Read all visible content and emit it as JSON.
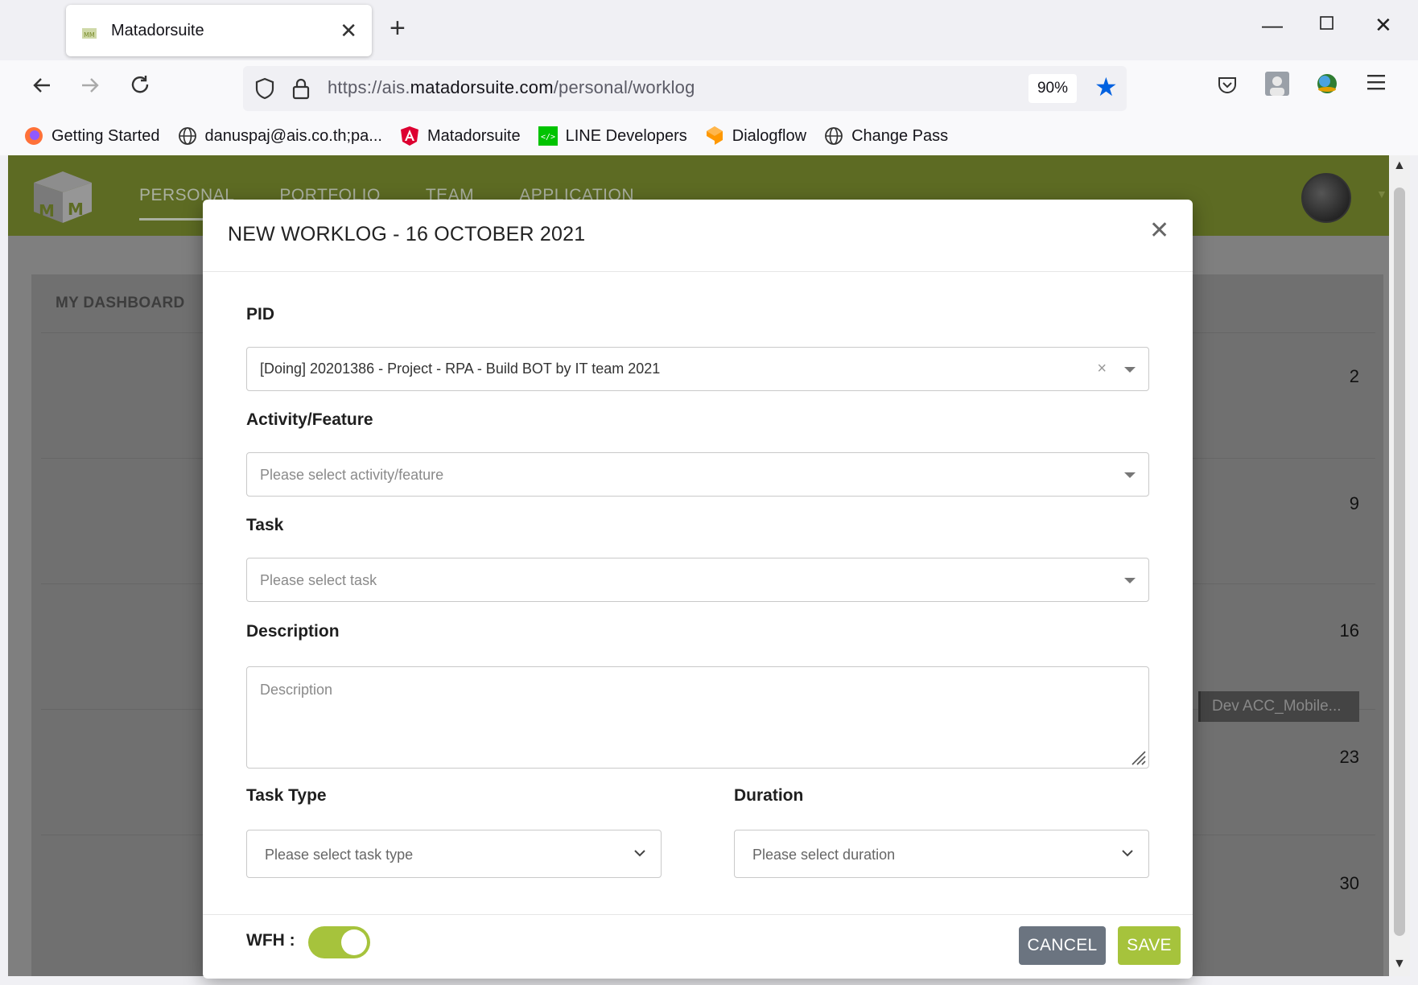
{
  "browser": {
    "tab_title": "Matadorsuite",
    "new_tab": "+",
    "url_prefix": "https://ais.",
    "url_domain": "matadorsuite.com",
    "url_path": "/personal/worklog",
    "zoom": "90%",
    "bookmarks": [
      {
        "label": "Getting Started",
        "icon": "firefox-icon"
      },
      {
        "label": "danuspaj@ais.co.th;pa...",
        "icon": "globe-icon"
      },
      {
        "label": "Matadorsuite",
        "icon": "angular-icon"
      },
      {
        "label": "LINE Developers",
        "icon": "line-icon"
      },
      {
        "label": "Dialogflow",
        "icon": "dialogflow-icon"
      },
      {
        "label": "Change Pass",
        "icon": "globe-icon"
      }
    ]
  },
  "app": {
    "nav": [
      "PERSONAL",
      "PORTFOLIO",
      "TEAM",
      "APPLICATION"
    ],
    "dashboard_tab": "MY DASHBOARD",
    "day_numbers": [
      "2",
      "9",
      "16",
      "23",
      "30"
    ],
    "event_chip": "Dev ACC_Mobile..."
  },
  "modal": {
    "title": "NEW WORKLOG - 16 OCTOBER 2021",
    "pid_label": "PID",
    "pid_value": "[Doing] 20201386 - Project - RPA - Build BOT by IT team 2021",
    "activity_label": "Activity/Feature",
    "activity_placeholder": "Please select activity/feature",
    "task_label": "Task",
    "task_placeholder": "Please select task",
    "description_label": "Description",
    "description_placeholder": "Description",
    "task_type_label": "Task Type",
    "task_type_placeholder": "Please select task type",
    "duration_label": "Duration",
    "duration_placeholder": "Please select duration",
    "wfh_label": "WFH :",
    "wfh_on": true,
    "cancel_label": "CANCEL",
    "save_label": "SAVE"
  },
  "colors": {
    "header_green": "#5d6b23",
    "accent_lime": "#a6c33c",
    "cancel_gray": "#6b7480",
    "bookmark_blue": "#0061e0"
  }
}
